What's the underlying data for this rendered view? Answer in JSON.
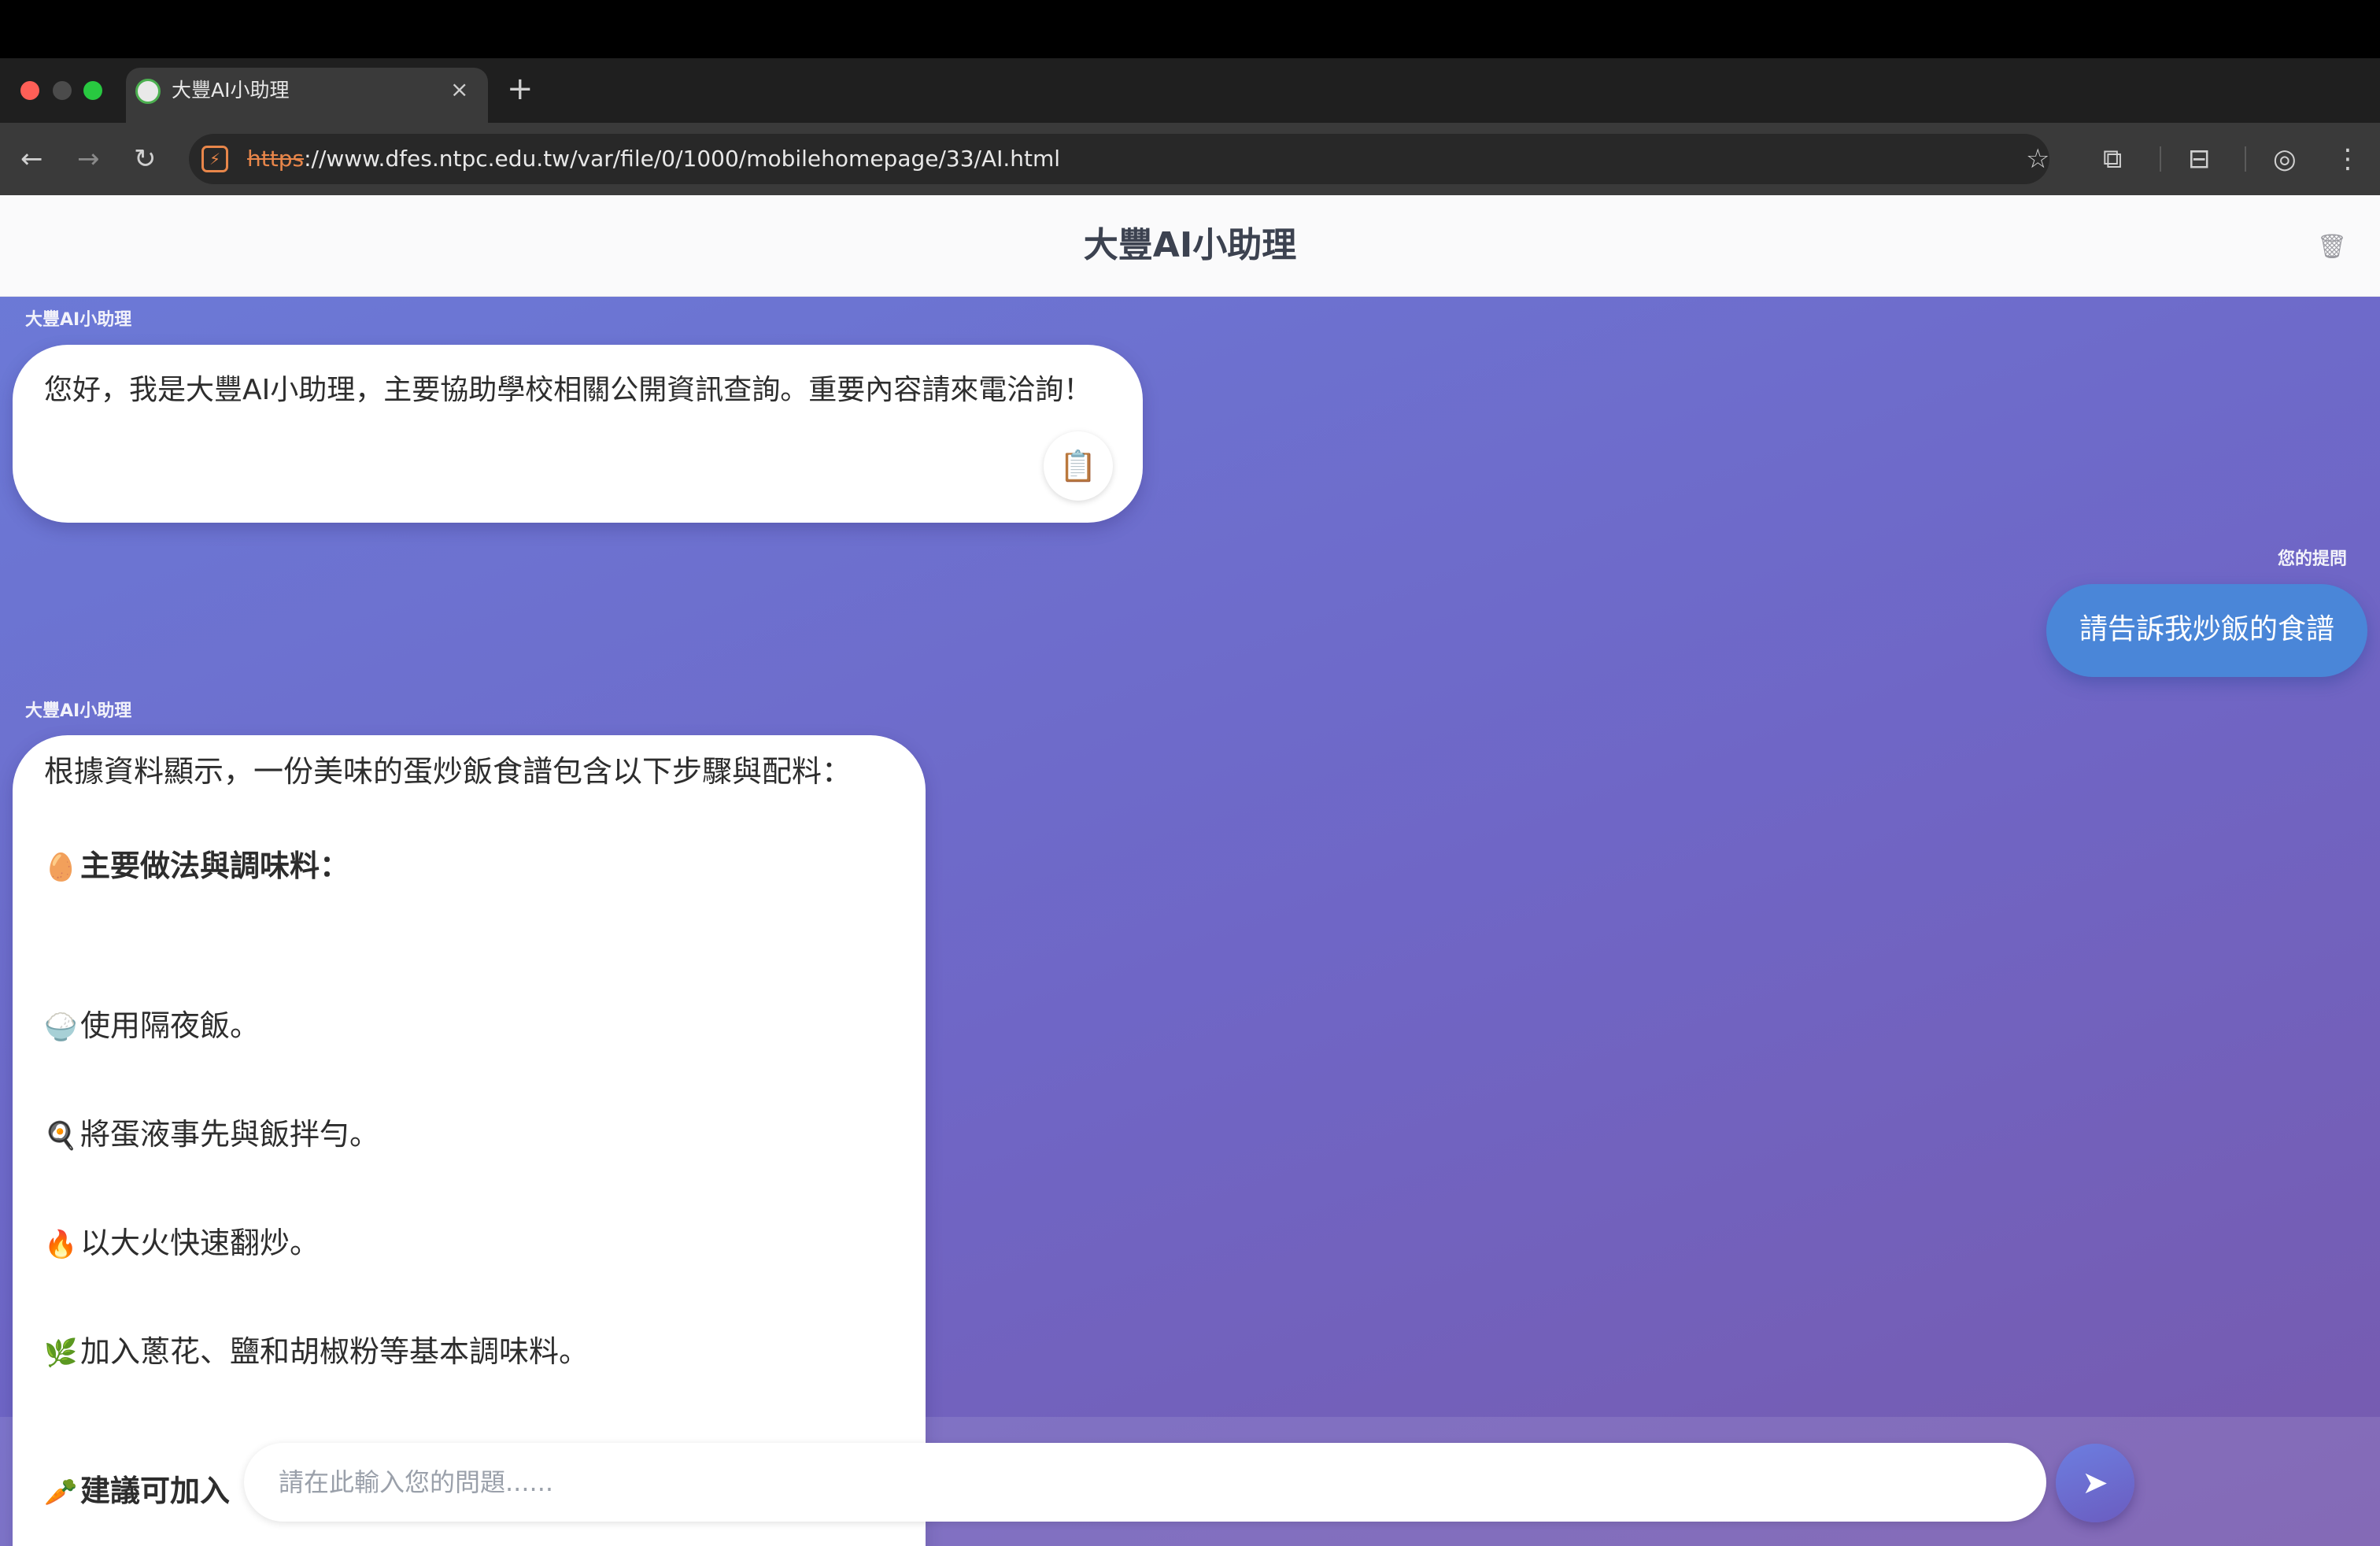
{
  "browser": {
    "tab_title": "大豐AI小助理",
    "tab_close": "×",
    "new_tab": "+",
    "url_scheme": "https",
    "url_rest": "://www.dfes.ntpc.edu.tw/var/file/0/1000/mobilehomepage/33/AI.html",
    "icons": {
      "back": "←",
      "forward": "→",
      "reload": "↻",
      "star": "☆",
      "extensions": "⧉",
      "media": "⊟",
      "profile": "◎",
      "menu": "⋮",
      "site": "⚡"
    }
  },
  "header": {
    "title": "大豐AI小助理",
    "trash_icon": "🗑"
  },
  "chat": {
    "messages": [
      {
        "sender": "大豐AI小助理",
        "text": "您好，我是大豐AI小助理，主要協助學校相關公開資訊查詢。重要內容請來電洽詢！",
        "copy_icon": "📋"
      },
      {
        "sender": "您的提問",
        "text": "請告訴我炒飯的食譜"
      },
      {
        "sender": "大豐AI小助理",
        "lines": [
          {
            "emoji": "",
            "text": "根據資料顯示，一份美味的蛋炒飯食譜包含以下步驟與配料："
          },
          {
            "emoji": "🥚",
            "text": "主要做法與調味料："
          },
          {
            "emoji": "🍚",
            "text": "使用隔夜飯。"
          },
          {
            "emoji": "🍳",
            "text": "將蛋液事先與飯拌勻。"
          },
          {
            "emoji": "🔥",
            "text": "以大火快速翻炒。"
          },
          {
            "emoji": "🌿",
            "text": "加入蔥花、鹽和胡椒粉等基本調味料。"
          },
          {
            "emoji": "🥕",
            "text": "建議可加入"
          }
        ]
      }
    ]
  },
  "input": {
    "placeholder": "請在此輸入您的問題......",
    "send_icon": "➤"
  }
}
